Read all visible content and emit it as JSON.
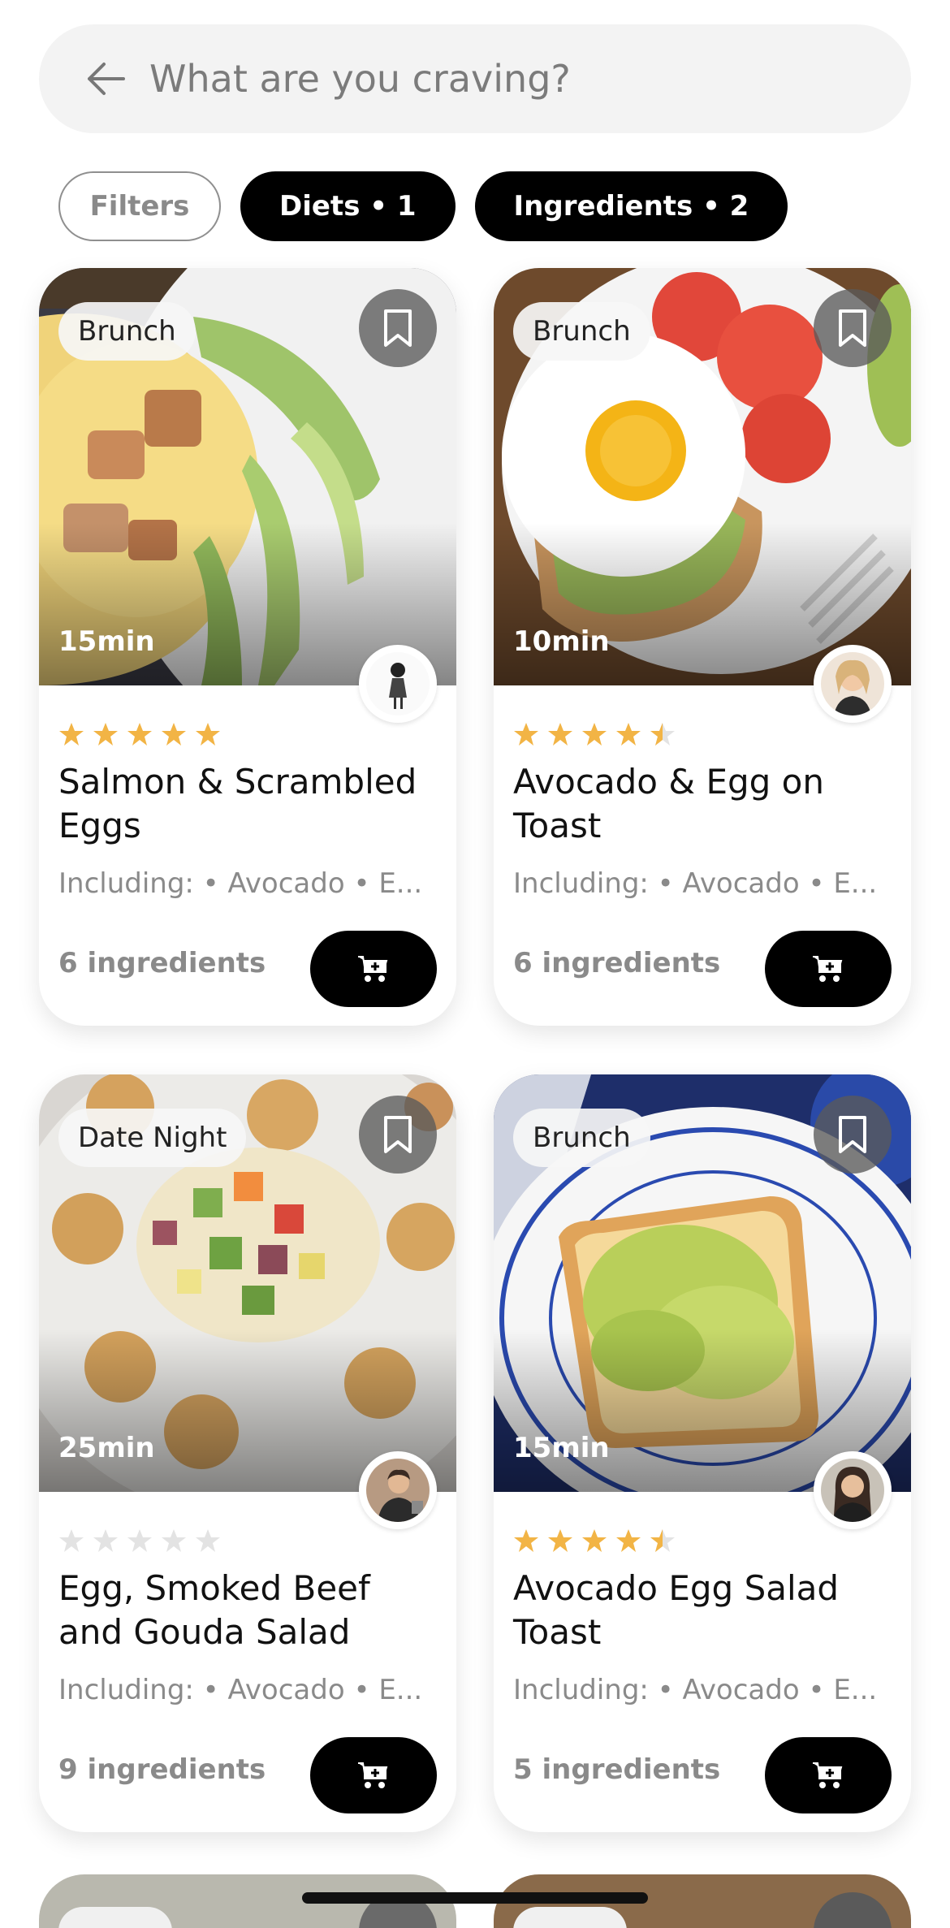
{
  "search": {
    "placeholder": "What are you craving?"
  },
  "chips": [
    {
      "label": "Filters"
    },
    {
      "label": "Diets • 1"
    },
    {
      "label": "Ingredients • 2"
    }
  ],
  "cards": [
    {
      "tag": "Brunch",
      "duration": "15min",
      "rating": 5,
      "title": "Salmon & Scrambled Eggs",
      "including": "Including:  • Avocado  • E...",
      "count": "6 ingredients"
    },
    {
      "tag": "Brunch",
      "duration": "10min",
      "rating": 4.5,
      "title": "Avocado & Egg on Toast",
      "including": "Including:  • Avocado  • E...",
      "count": "6 ingredients"
    },
    {
      "tag": "Date Night",
      "duration": "25min",
      "rating": 0,
      "title": "Egg, Smoked Beef and Gouda Salad",
      "including": "Including:  • Avocado  • E...",
      "count": "9 ingredients"
    },
    {
      "tag": "Brunch",
      "duration": "15min",
      "rating": 4.5,
      "title": "Avocado Egg Salad Toast",
      "including": "Including:  • Avocado  • E...",
      "count": "5 ingredients"
    }
  ],
  "colors": {
    "star_filled": "#f2b445",
    "star_empty": "#e3e3e3",
    "chip_dark": "#000000"
  },
  "icons": {
    "back": "arrow-left-icon",
    "bookmark": "bookmark-icon",
    "cart": "cart-add-icon"
  }
}
